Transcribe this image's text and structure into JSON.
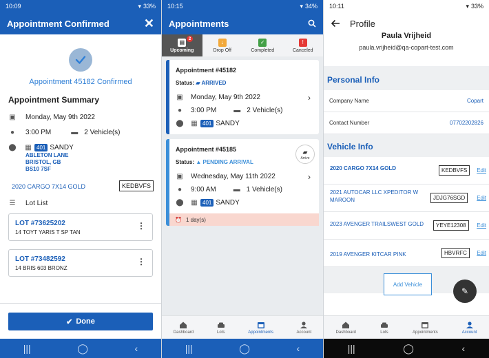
{
  "screen1": {
    "status": {
      "time": "10:09",
      "battery": "33%"
    },
    "title": "Appointment Confirmed",
    "confirmation": "Appointment 45182 Confirmed",
    "summary_title": "Appointment Summary",
    "date": "Monday, May 9th 2022",
    "time": "3:00 PM",
    "vehicles": "2 Vehicle(s)",
    "location_badge": "401",
    "location": "SANDY",
    "address_lines": [
      "ABLETON LANE",
      "BRISTOL, GB",
      "BS10 7SF"
    ],
    "vehicle": {
      "name": "2020 CARGO 7X14 GOLD",
      "plate": "KEDBVFS"
    },
    "lot_list_label": "Lot List",
    "lots": [
      {
        "number": "LOT #73625202",
        "desc": "14 TOYT YARIS T SP TAN"
      },
      {
        "number": "LOT #73482592",
        "desc": "14 BRIS 603 BRONZ"
      }
    ],
    "done_label": "Done"
  },
  "screen2": {
    "status": {
      "time": "10:15",
      "battery": "34%"
    },
    "title": "Appointments",
    "tabs": [
      {
        "label": "Upcoming",
        "count": "2"
      },
      {
        "label": "Drop Off"
      },
      {
        "label": "Completed"
      },
      {
        "label": "Canceled"
      }
    ],
    "appointments": [
      {
        "title": "Appointment #45182",
        "status_label": "Status:",
        "status": "ARRIVED",
        "date": "Monday, May 9th 2022",
        "time": "3:00 PM",
        "vehicles": "2 Vehicle(s)",
        "badge": "401",
        "location": "SANDY"
      },
      {
        "title": "Appointment #45185",
        "status_label": "Status:",
        "status": "PENDING ARRIVAL",
        "date": "Wednesday, May 11th 2022",
        "time": "9:00 AM",
        "vehicles": "1 Vehicle(s)",
        "badge": "401",
        "location": "SANDY",
        "arrive_label": "Arrive",
        "days": "1 day(s)"
      }
    ],
    "bottom_nav": [
      "Dashboard",
      "Lots",
      "Appointments",
      "Account"
    ]
  },
  "screen3": {
    "status": {
      "time": "10:11",
      "battery": "33%"
    },
    "title": "Profile",
    "name": "Paula Vrijheid",
    "email": "paula.vrijheid@qa-copart-test.com",
    "personal_info_title": "Personal Info",
    "company_label": "Company Name",
    "company_value": "Copart",
    "contact_label": "Contact Number",
    "contact_value": "07702202826",
    "vehicle_info_title": "Vehicle Info",
    "vehicles": [
      {
        "name": "2020 CARGO 7X14 GOLD",
        "plate": "KEDBVFS"
      },
      {
        "name": "2021 AUTOCAR LLC XPEDITOR W MAROON",
        "plate": "JDJG76SGD"
      },
      {
        "name": "2023 AVENGER TRAILSWEST GOLD",
        "plate": "YEYE12308"
      },
      {
        "name": "2019 AVENGER KITCAR PINK",
        "plate": "HBVRFC"
      }
    ],
    "edit_label": "Edit",
    "add_vehicle_label": "Add Vehicle",
    "bottom_nav": [
      "Dashboard",
      "Lots",
      "Appointments",
      "Account"
    ]
  },
  "colors": {
    "primary": "#1b5fb8",
    "accent": "#3b8fd9",
    "alert_bg": "#f9d7cf"
  }
}
